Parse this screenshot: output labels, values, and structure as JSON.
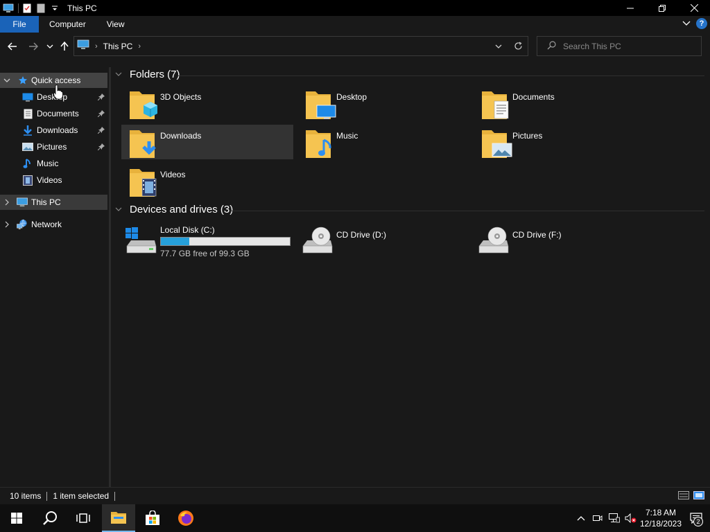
{
  "window": {
    "title": "This PC"
  },
  "ribbon": {
    "tabs": [
      "File",
      "Computer",
      "View"
    ]
  },
  "address": {
    "crumb": "This PC"
  },
  "search": {
    "placeholder": "Search This PC"
  },
  "nav": {
    "quick_access": "Quick access",
    "quick_items": [
      {
        "label": "Desktop",
        "icon": "desktop-icon",
        "pinned": true
      },
      {
        "label": "Documents",
        "icon": "documents-icon",
        "pinned": true
      },
      {
        "label": "Downloads",
        "icon": "downloads-icon",
        "pinned": true
      },
      {
        "label": "Pictures",
        "icon": "pictures-icon",
        "pinned": true
      },
      {
        "label": "Music",
        "icon": "music-icon",
        "pinned": false
      },
      {
        "label": "Videos",
        "icon": "videos-icon",
        "pinned": false
      }
    ],
    "this_pc": "This PC",
    "network": "Network"
  },
  "folders": {
    "header": "Folders (7)",
    "items": [
      "3D Objects",
      "Desktop",
      "Documents",
      "Downloads",
      "Music",
      "Pictures",
      "Videos"
    ]
  },
  "drives": {
    "header": "Devices and drives (3)",
    "local": {
      "name": "Local Disk (C:)",
      "free_text": "77.7 GB free of 99.3 GB",
      "used_fraction": 0.218
    },
    "cd_d": "CD Drive (D:)",
    "cd_f": "CD Drive (F:)"
  },
  "status": {
    "items": "10 items",
    "selected": "1 item selected"
  },
  "clock": {
    "time": "7:18 AM",
    "date": "12/18/2023"
  },
  "notifications": {
    "count": "2"
  },
  "colors": {
    "accent": "#1a63b8",
    "folder": "#f5c451",
    "drive_fill": "#26a0da"
  }
}
